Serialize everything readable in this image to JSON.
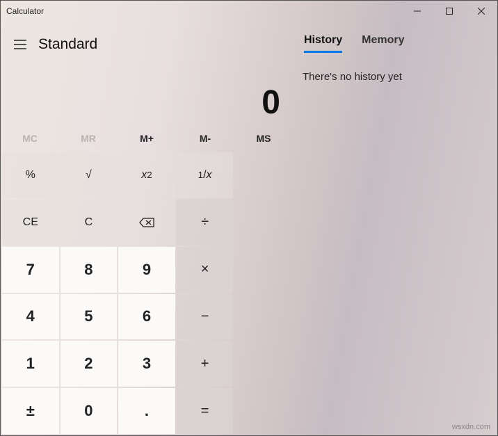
{
  "window": {
    "title": "Calculator"
  },
  "mode": {
    "label": "Standard"
  },
  "display": {
    "value": "0"
  },
  "memory": {
    "mc": "MC",
    "mr": "MR",
    "mplus": "M+",
    "mminus": "M-",
    "ms": "MS"
  },
  "keys": {
    "percent": "%",
    "sqrt": "√",
    "sqr_x": "x",
    "sqr_sup": "2",
    "recip_one": "1",
    "recip_x": "x",
    "ce": "CE",
    "c": "C",
    "div": "÷",
    "mul": "×",
    "sub": "−",
    "add": "+",
    "eq": "=",
    "n7": "7",
    "n8": "8",
    "n9": "9",
    "n4": "4",
    "n5": "5",
    "n6": "6",
    "n1": "1",
    "n2": "2",
    "n3": "3",
    "n0": "0",
    "sign": "±",
    "dot": "."
  },
  "tabs": {
    "history": "History",
    "memory": "Memory"
  },
  "history": {
    "empty": "There's no history yet"
  },
  "watermark": "wsxdn.com"
}
